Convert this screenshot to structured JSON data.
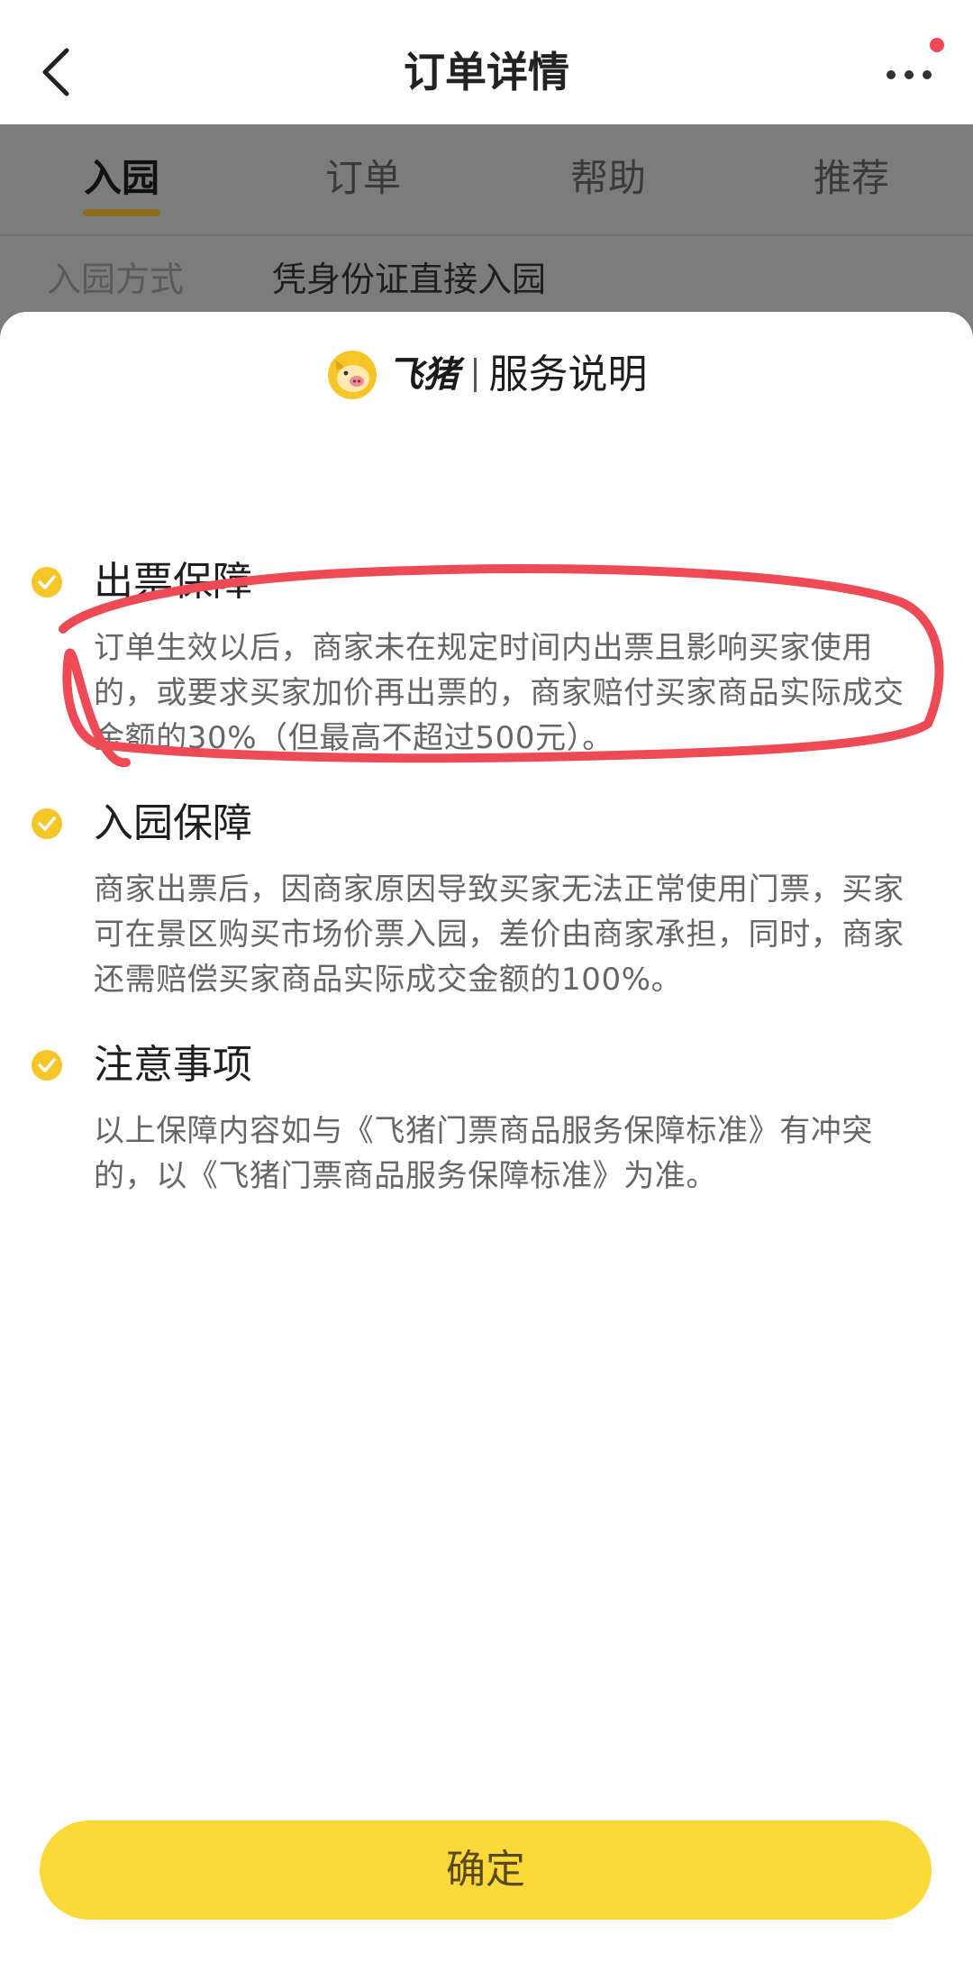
{
  "navbar": {
    "title": "订单详情"
  },
  "tabs": [
    {
      "label": "入园",
      "active": true
    },
    {
      "label": "订单",
      "active": false
    },
    {
      "label": "帮助",
      "active": false
    },
    {
      "label": "推荐",
      "active": false
    }
  ],
  "entry": {
    "label": "入园方式",
    "value": "凭身份证直接入园"
  },
  "sheet": {
    "brand": "飞猪",
    "title": "服务说明",
    "sections": [
      {
        "title": "出票保障",
        "body": "订单生效以后，商家未在规定时间内出票且影响买家使用的，或要求买家加价再出票的，商家赔付买家商品实际成交金额的30%（但最高不超过500元）。"
      },
      {
        "title": "入园保障",
        "body": "商家出票后，因商家原因导致买家无法正常使用门票，买家可在景区购买市场价票入园，差价由商家承担，同时，商家还需赔偿买家商品实际成交金额的100%。"
      },
      {
        "title": "注意事项",
        "body": "以上保障内容如与《飞猪门票商品服务保障标准》有冲突的，以《飞猪门票商品服务保障标准》为准。"
      }
    ],
    "confirm_label": "确定"
  },
  "icons": {
    "back": "chevron-left-icon",
    "more": "more-dots-icon",
    "brand": "fliggy-pig-logo",
    "check": "check-circle-icon"
  },
  "colors": {
    "accent_yellow": "#fbd93b",
    "check_yellow": "#f6c628",
    "annotation_red": "#ee4a55",
    "backdrop_gray": "#7c7c7c"
  }
}
